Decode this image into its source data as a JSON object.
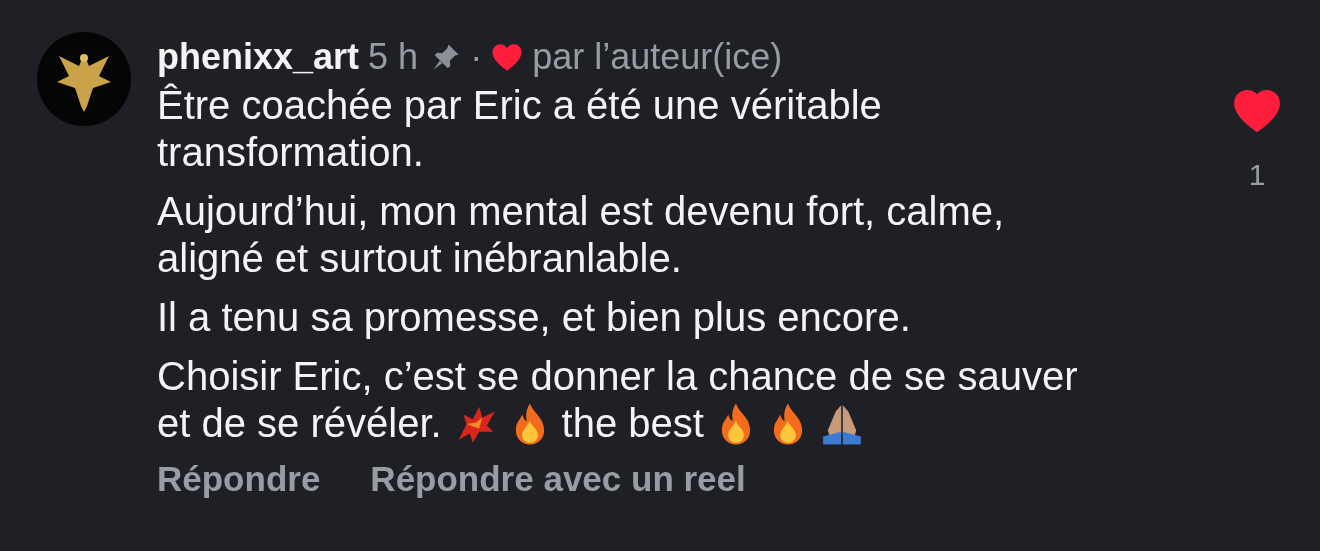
{
  "comment": {
    "author": "phenixx_art",
    "time": "5 h",
    "pinned": true,
    "liked_by_author": true,
    "separator": "·",
    "author_label": "par l’auteur(ice)",
    "paragraphs": [
      [
        {
          "kind": "text",
          "text": "Être coachée par Eric a été une véritable transformation."
        }
      ],
      [
        {
          "kind": "text",
          "text": "Aujourd’hui, mon mental est devenu fort, calme, aligné et surtout inébranlable."
        }
      ],
      [
        {
          "kind": "text",
          "text": "Il a tenu sa promesse, et bien plus encore."
        }
      ],
      [
        {
          "kind": "text",
          "text": "Choisir Eric, c’est se donner la chance de se sauver"
        },
        {
          "kind": "text",
          "text": "et de se révéler."
        },
        {
          "kind": "phoenix"
        },
        {
          "kind": "fire"
        },
        {
          "kind": "text",
          "text": "the best"
        },
        {
          "kind": "fire"
        },
        {
          "kind": "fire"
        },
        {
          "kind": "hands"
        }
      ]
    ],
    "liked": true,
    "like_count": "1",
    "actions": [
      "Répondre",
      "Répondre avec un reel"
    ]
  }
}
